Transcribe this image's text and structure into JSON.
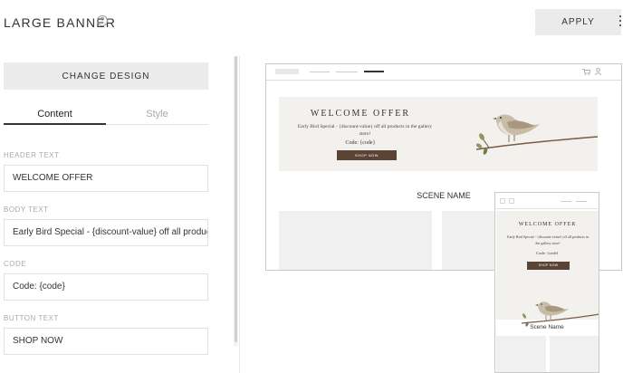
{
  "header": {
    "title": "LARGE BANNER",
    "help_glyph": "?",
    "apply_label": "APPLY"
  },
  "left_panel": {
    "change_design_label": "CHANGE DESIGN",
    "tabs": [
      {
        "label": "Content",
        "active": true
      },
      {
        "label": "Style",
        "active": false
      }
    ],
    "fields": {
      "header_text": {
        "label": "HEADER TEXT",
        "value": "WELCOME OFFER"
      },
      "body_text": {
        "label": "BODY TEXT",
        "value": "Early Bird Special - {discount-value} off all products in the gallery store!"
      },
      "code": {
        "label": "CODE",
        "value": "Code: {code}"
      },
      "button_text": {
        "label": "BUTTON TEXT",
        "value": "SHOP NOW"
      }
    }
  },
  "preview": {
    "desktop": {
      "hero_title": "WELCOME OFFER",
      "hero_body": "Early Bird Special - {discount-value} off all products in the gallery store!",
      "hero_code": "Code: {code}",
      "hero_button": "SHOP NOW",
      "scene_name": "SCENE NAME",
      "cart_icon": "cart-icon",
      "user_icon": "user-icon"
    },
    "mobile": {
      "hero_title": "WELCOME OFFER",
      "hero_body": "Early Bird Special - {discount-value} off all products in the gallery store!",
      "hero_code": "Code: {code}",
      "hero_button": "SHOP NOW",
      "scene_name": "Scene Name"
    }
  },
  "colors": {
    "button_brown": "#5b4335",
    "hero_bg": "#f2f1ee",
    "panel_button": "#ebebeb"
  }
}
